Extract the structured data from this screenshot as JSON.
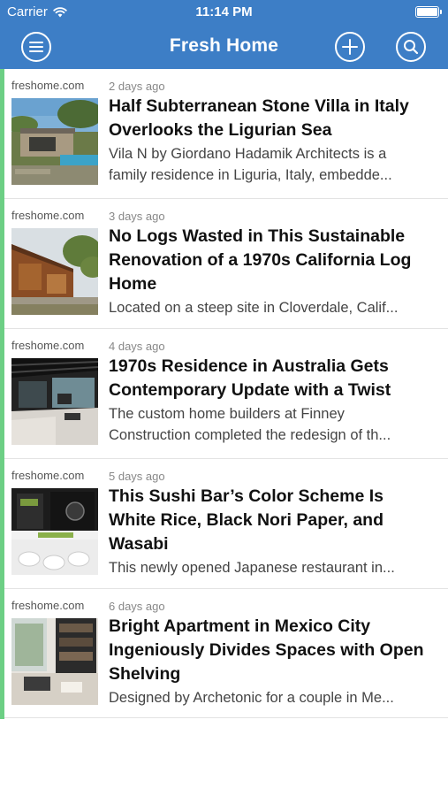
{
  "status_bar": {
    "carrier": "Carrier",
    "time": "11:14 PM",
    "battery_level": 1.0
  },
  "nav": {
    "title": "Fresh Home",
    "menu_icon": "hamburger-menu-icon",
    "add_icon": "plus-circle-icon",
    "search_icon": "search-icon",
    "bar_color": "#3d7ec6"
  },
  "feed": {
    "accent_color": "#6ccf84",
    "articles": [
      {
        "source": "freshome.com",
        "age": "2 days ago",
        "title_lines": [
          "Half Subterranean Stone Villa in Italy",
          "Overlooks the Ligurian Sea"
        ],
        "excerpt_lines": [
          "Vila N by Giordano Hadamik Architects is a",
          "family residence in Liguria, Italy, embedde..."
        ]
      },
      {
        "source": "freshome.com",
        "age": "3 days ago",
        "title_lines": [
          "No Logs Wasted in This Sustainable",
          "Renovation of a 1970s California Log",
          "Home"
        ],
        "excerpt_lines": [
          "Located on a steep site in Cloverdale, Calif..."
        ]
      },
      {
        "source": "freshome.com",
        "age": "4 days ago",
        "title_lines": [
          "1970s Residence in Australia Gets",
          "Contemporary Update with a Twist"
        ],
        "excerpt_lines": [
          "The custom home builders at Finney",
          "Construction completed the redesign of th..."
        ]
      },
      {
        "source": "freshome.com",
        "age": "5 days ago",
        "title_lines": [
          "This Sushi Bar’s Color Scheme Is",
          "White Rice, Black Nori Paper, and",
          "Wasabi"
        ],
        "excerpt_lines": [
          "This newly opened Japanese restaurant in..."
        ]
      },
      {
        "source": "freshome.com",
        "age": "6 days ago",
        "title_lines": [
          "Bright Apartment in Mexico City",
          "Ingeniously Divides Spaces with Open",
          "Shelving"
        ],
        "excerpt_lines": [
          "Designed by Archetonic for a couple in Me..."
        ]
      }
    ]
  }
}
